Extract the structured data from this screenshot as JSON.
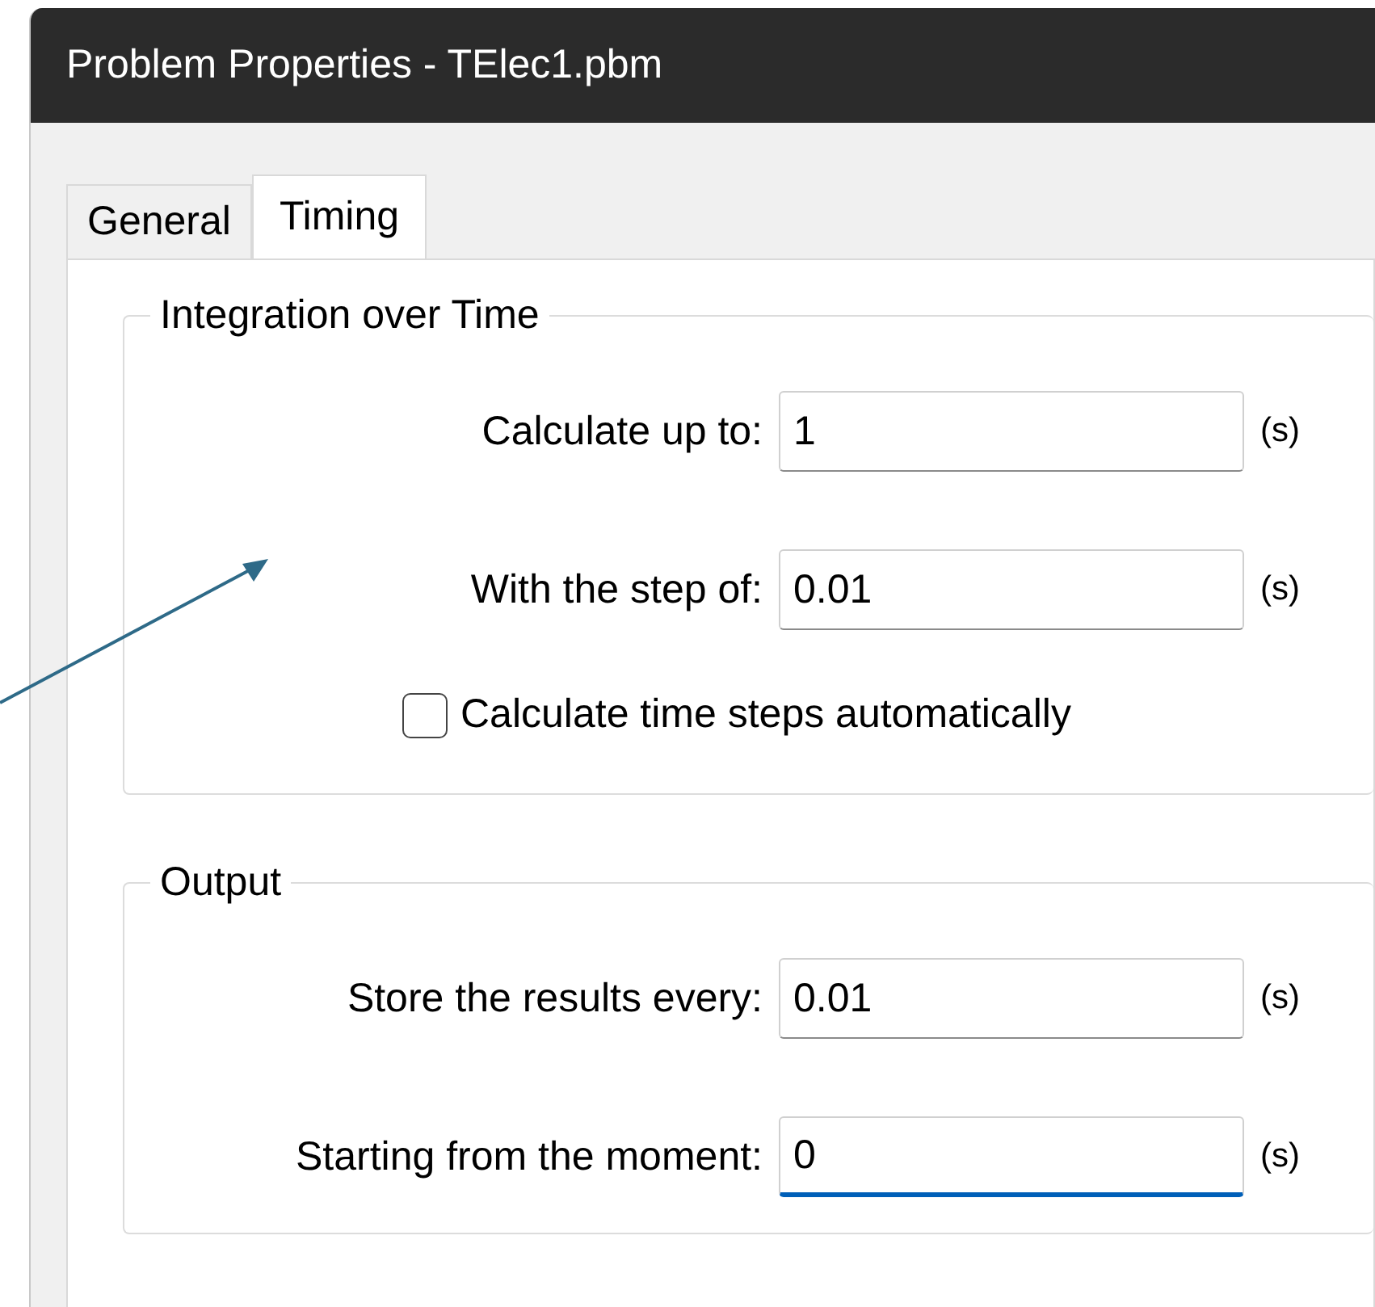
{
  "window": {
    "title": "Problem Properties - TElec1.pbm"
  },
  "tabs": [
    {
      "label": "General",
      "selected": false
    },
    {
      "label": "Timing",
      "selected": true
    }
  ],
  "groups": [
    {
      "legend": "Integration over Time",
      "rows": [
        {
          "kind": "field",
          "label": "Calculate up to:",
          "value": "1",
          "unit": "(s)",
          "focused": false
        },
        {
          "kind": "field",
          "label": "With the step of:",
          "value": "0.01",
          "unit": "(s)",
          "focused": false
        },
        {
          "kind": "checkbox",
          "label": "Calculate time steps automatically",
          "checked": false
        }
      ]
    },
    {
      "legend": "Output",
      "rows": [
        {
          "kind": "field",
          "label": "Store the results every:",
          "value": "0.01",
          "unit": "(s)",
          "focused": false
        },
        {
          "kind": "field",
          "label": "Starting from the moment:",
          "value": "0",
          "unit": "(s)",
          "focused": true
        }
      ]
    }
  ]
}
